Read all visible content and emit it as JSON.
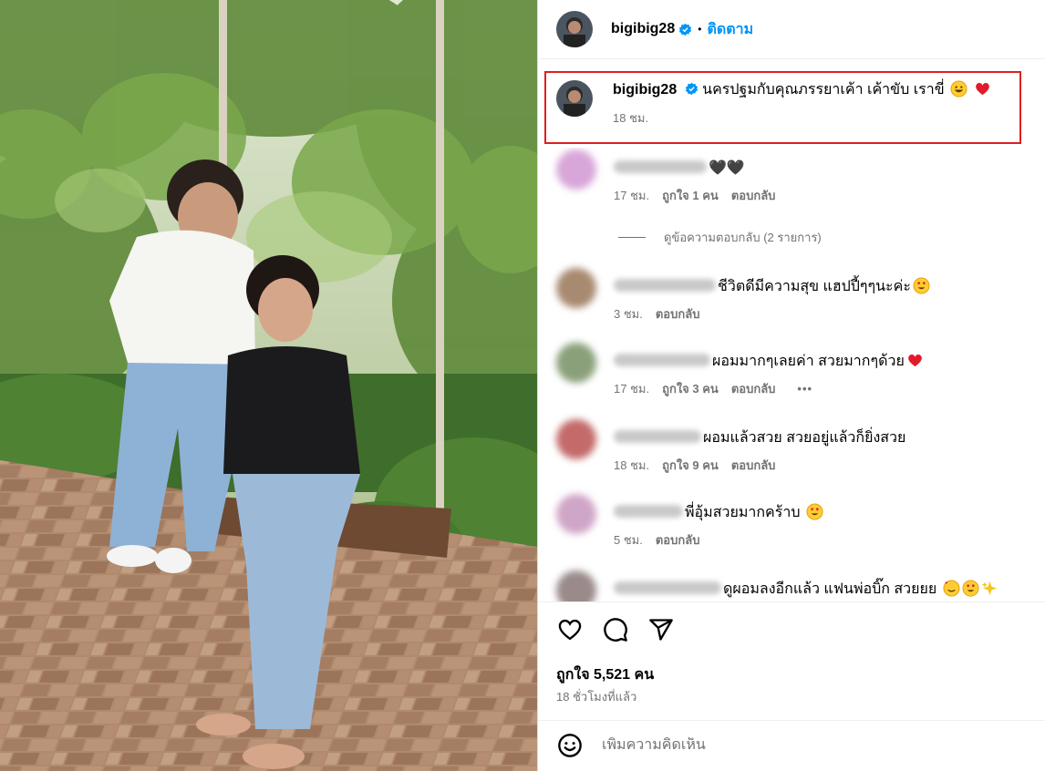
{
  "post": {
    "username": "bigibig28",
    "follow_label": "ติดตาม",
    "separator": "•",
    "caption": "นครปฐมกับคุณภรรยาเค้า เค้าขับ เราขี่",
    "caption_time": "18 ชม.",
    "likes_text": "ถูกใจ 5,521 คน",
    "time_ago": "18 ชั่วโมงที่แล้ว",
    "add_comment_placeholder": "เพิ่มความคิดเห็น"
  },
  "comments": [
    {
      "text": "🖤🖤",
      "time": "17 ชม.",
      "likes": "ถูกใจ 1 คน",
      "reply": "ตอบกลับ",
      "avatar_color": "#d8a6d8"
    },
    {
      "text": "ชีวิตดีมีความสุข แฮปปี้ๆๆนะค่ะ",
      "time": "3 ชม.",
      "likes": "",
      "reply": "ตอบกลับ",
      "avatar_color": "#a88a70"
    },
    {
      "text": "ผอมมากๆเลยค่า สวยมากๆด้วย",
      "time": "17 ชม.",
      "likes": "ถูกใจ 3 คน",
      "reply": "ตอบกลับ",
      "more": "•••",
      "avatar_color": "#8aa07a"
    },
    {
      "text": "ผอมแล้วสวย สวยอยู่แล้วก็ยิ่งสวย",
      "time": "18 ชม.",
      "likes": "ถูกใจ 9 คน",
      "reply": "ตอบกลับ",
      "avatar_color": "#c46a6a"
    },
    {
      "text": "พี่อุ้มสวยมากคร้าบ",
      "time": "5 ชม.",
      "likes": "",
      "reply": "ตอบกลับ",
      "avatar_color": "#d0a6c8"
    },
    {
      "text": "ดูผอมลงอีกแล้ว แฟนพ่อบิ๊ก สวยยย",
      "time": "",
      "likes": "",
      "reply": "",
      "avatar_color": "#9a8a8a"
    }
  ],
  "view_replies": "ดูข้อความตอบกลับ (2 รายการ)",
  "colors": {
    "accent": "#0095f6",
    "highlight_border": "#e01e1e",
    "muted": "#737373"
  },
  "icons": [
    "verified-badge-icon",
    "heart-icon",
    "comment-icon",
    "share-icon",
    "smiley-icon"
  ]
}
